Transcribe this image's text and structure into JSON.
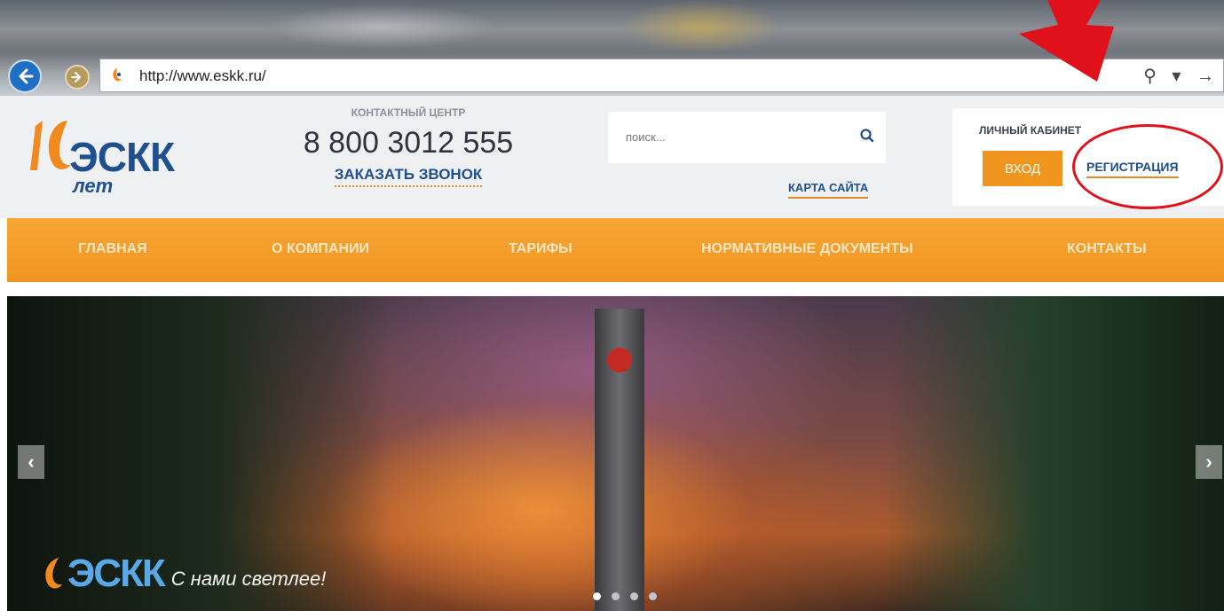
{
  "browser": {
    "url": "http://www.eskk.ru/",
    "tools": "⚲ ▾ →"
  },
  "header": {
    "logo_text": "ЭСКК",
    "logo_years": "10",
    "logo_subtitle": "лет",
    "contact_label": "КОНТАКТНЫЙ ЦЕНТР",
    "contact_phone": "8 800 3012 555",
    "order_call": "ЗАКАЗАТЬ ЗВОНОК",
    "search_placeholder": "поиск...",
    "sitemap": "КАРТА САЙТА",
    "cabinet_label": "ЛИЧНЫЙ КАБИНЕТ",
    "login": "ВХОД",
    "register": "РЕГИСТРАЦИЯ"
  },
  "nav": {
    "items": [
      {
        "label": "ГЛАВНАЯ"
      },
      {
        "label": "О КОМПАНИИ"
      },
      {
        "label": "ТАРИФЫ"
      },
      {
        "label": "НОРМАТИВНЫЕ ДОКУМЕНТЫ"
      },
      {
        "label": "КОНТАКТЫ"
      }
    ]
  },
  "slider": {
    "logo_text": "ЭСКК",
    "slogan": "С нами светлее!",
    "prev": "‹",
    "next": "›",
    "dot_count": 4,
    "active_dot": 0
  },
  "colors": {
    "accent": "#f0961e",
    "brand": "#1f4f8f",
    "annotation": "#e0111b"
  }
}
